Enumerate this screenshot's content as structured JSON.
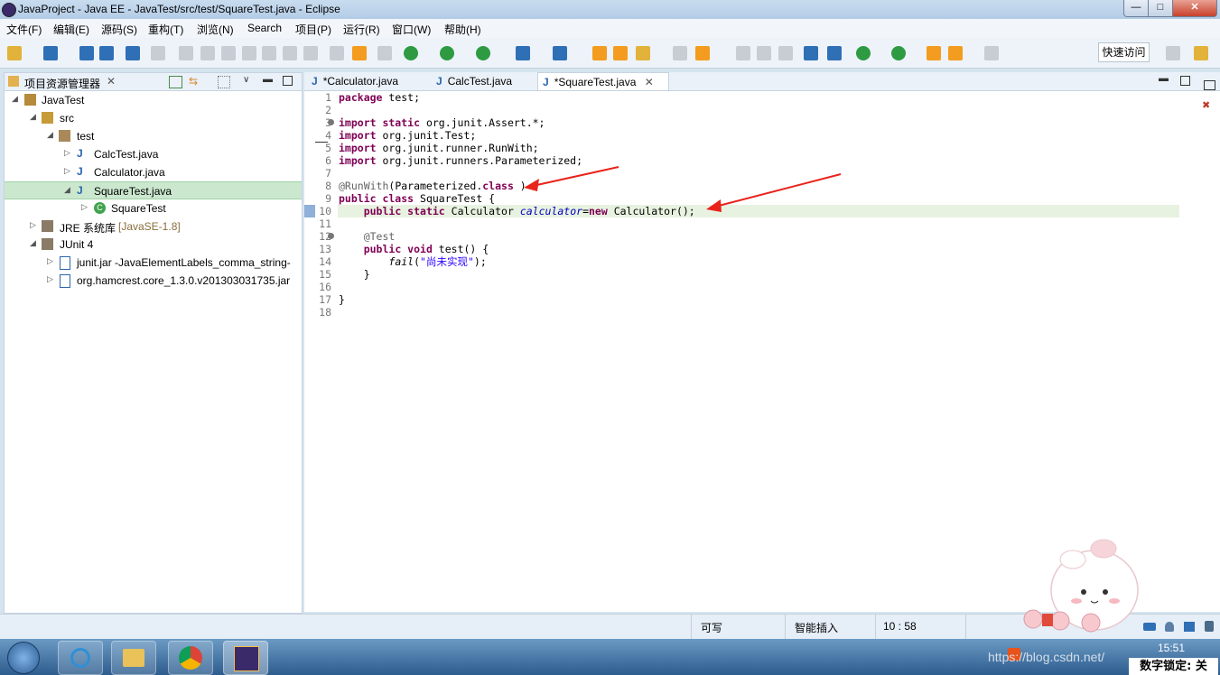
{
  "window": {
    "title": "JavaProject - Java EE - JavaTest/src/test/SquareTest.java - Eclipse",
    "min": "—",
    "max": "□",
    "close": "✕"
  },
  "menu": [
    "文件(F)",
    "编辑(E)",
    "源码(S)",
    "重构(T)",
    "浏览(N)",
    "Search",
    "项目(P)",
    "运行(R)",
    "窗口(W)",
    "帮助(H)"
  ],
  "toolbar": {
    "quick_access": "快速访问"
  },
  "explorer": {
    "title": "项目资源管理器",
    "tree": [
      {
        "label": "JavaTest",
        "extra": ""
      },
      {
        "label": "src",
        "extra": ""
      },
      {
        "label": "test",
        "extra": ""
      },
      {
        "label": "CalcTest.java",
        "extra": ""
      },
      {
        "label": "Calculator.java",
        "extra": ""
      },
      {
        "label": "SquareTest.java",
        "extra": ""
      },
      {
        "label": "SquareTest",
        "extra": ""
      },
      {
        "label": "JRE 系统库",
        "extra": "[JavaSE-1.8]"
      },
      {
        "label": "JUnit 4",
        "extra": ""
      },
      {
        "label": "junit.jar -JavaElementLabels_comma_string-",
        "extra": ""
      },
      {
        "label": "org.hamcrest.core_1.3.0.v201303031735.jar",
        "extra": ""
      }
    ]
  },
  "editor": {
    "tabs": [
      "*Calculator.java",
      "CalcTest.java",
      "*SquareTest.java"
    ],
    "line_numbers": [
      "1",
      "2",
      "3",
      "4",
      "5",
      "6",
      "7",
      "8",
      "9",
      "10",
      "11",
      "12",
      "13",
      "14",
      "15",
      "16",
      "17",
      "18"
    ]
  },
  "statusbar": {
    "writable": "可写",
    "insert_mode": "智能插入",
    "position": "10 : 58"
  },
  "taskbar": {
    "time": "15:51",
    "watermark": "https://blog.csdn.net/",
    "numlock": "数字锁定: 关"
  },
  "colors": {
    "keyword": "#7f0055",
    "annotation": "#646464",
    "field": "#0000c0",
    "string": "#2a00ff",
    "arrow": "#e8231b",
    "selection": "#cbe8cf"
  }
}
